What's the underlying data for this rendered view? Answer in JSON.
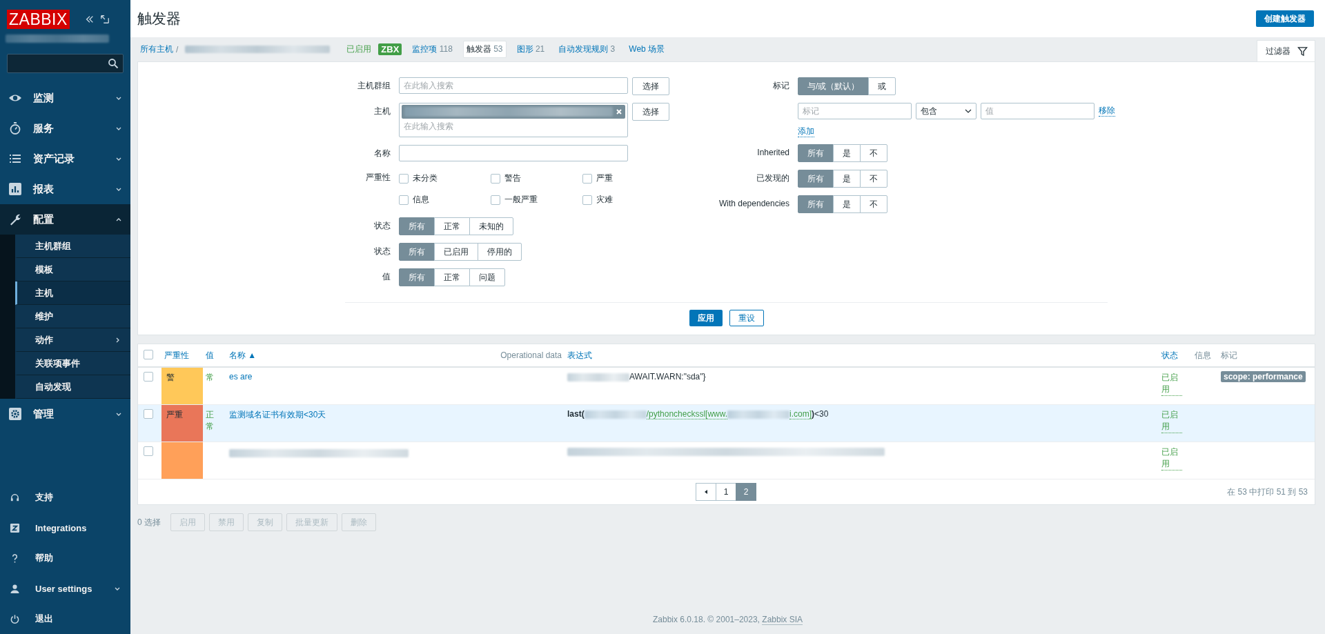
{
  "sidebar": {
    "logo": "ZABBIX",
    "menu": [
      {
        "label": "监测",
        "expanded": false
      },
      {
        "label": "服务",
        "expanded": false
      },
      {
        "label": "资产记录",
        "expanded": false
      },
      {
        "label": "报表",
        "expanded": false
      },
      {
        "label": "配置",
        "expanded": true,
        "children": [
          {
            "label": "主机群组",
            "selected": false,
            "submenu": false
          },
          {
            "label": "模板",
            "selected": false,
            "submenu": false
          },
          {
            "label": "主机",
            "selected": true,
            "submenu": false
          },
          {
            "label": "维护",
            "selected": false,
            "submenu": false
          },
          {
            "label": "动作",
            "selected": false,
            "submenu": true
          },
          {
            "label": "关联项事件",
            "selected": false,
            "submenu": false
          },
          {
            "label": "自动发现",
            "selected": false,
            "submenu": false
          }
        ]
      },
      {
        "label": "管理",
        "expanded": false
      }
    ],
    "bottom": [
      {
        "label": "支持",
        "submenu": false
      },
      {
        "label": "Integrations",
        "submenu": false
      },
      {
        "label": "帮助",
        "submenu": false
      },
      {
        "label": "User settings",
        "submenu": true
      },
      {
        "label": "退出",
        "submenu": false
      }
    ]
  },
  "header": {
    "title": "触发器",
    "create_button": "创建触发器"
  },
  "nav": {
    "all_hosts": "所有主机",
    "separator": "/",
    "host_status": "已启用",
    "zbx": "ZBX",
    "tabs": [
      {
        "label": "监控项",
        "count": "118",
        "selected": false
      },
      {
        "label": "触发器",
        "count": "53",
        "selected": true
      },
      {
        "label": "图形",
        "count": "21",
        "selected": false
      },
      {
        "label": "自动发现规则",
        "count": "3",
        "selected": false
      },
      {
        "label": "Web 场景",
        "selected": false
      }
    ],
    "filter_tab": "过滤器"
  },
  "filter": {
    "host_groups": {
      "label": "主机群组",
      "placeholder": "在此输入搜索",
      "button": "选择"
    },
    "host": {
      "label": "主机",
      "placeholder": "在此输入搜索",
      "button": "选择"
    },
    "name": {
      "label": "名称"
    },
    "severity": {
      "label": "严重性",
      "options": [
        {
          "label": "未分类",
          "checked": false
        },
        {
          "label": "警告",
          "checked": false
        },
        {
          "label": "严重",
          "checked": false
        },
        {
          "label": "信息",
          "checked": false
        },
        {
          "label": "一般严重",
          "checked": false
        },
        {
          "label": "灾难",
          "checked": false
        }
      ]
    },
    "left_groups": [
      {
        "label": "状态",
        "options": [
          {
            "label": "所有",
            "selected": true
          },
          {
            "label": "正常",
            "selected": false
          },
          {
            "label": "未知的",
            "selected": false
          }
        ]
      },
      {
        "label": "状态",
        "options": [
          {
            "label": "所有",
            "selected": true
          },
          {
            "label": "已启用",
            "selected": false
          },
          {
            "label": "停用的",
            "selected": false
          }
        ]
      },
      {
        "label": "值",
        "options": [
          {
            "label": "所有",
            "selected": true
          },
          {
            "label": "正常",
            "selected": false
          },
          {
            "label": "问题",
            "selected": false
          }
        ]
      }
    ],
    "tags": {
      "label": "标记",
      "options": [
        {
          "label": "与/或（默认）",
          "selected": true
        },
        {
          "label": "或",
          "selected": false
        }
      ],
      "tag_placeholder": "标记",
      "operator": "包含",
      "value_placeholder": "值",
      "remove": "移除",
      "add": "添加"
    },
    "right_groups": [
      {
        "label": "Inherited",
        "options": [
          {
            "label": "所有",
            "selected": true
          },
          {
            "label": "是",
            "selected": false
          },
          {
            "label": "不",
            "selected": false
          }
        ]
      },
      {
        "label": "已发现的",
        "options": [
          {
            "label": "所有",
            "selected": true
          },
          {
            "label": "是",
            "selected": false
          },
          {
            "label": "不",
            "selected": false
          }
        ]
      },
      {
        "label": "With dependencies",
        "options": [
          {
            "label": "所有",
            "selected": true
          },
          {
            "label": "是",
            "selected": false
          },
          {
            "label": "不",
            "selected": false
          }
        ]
      }
    ],
    "apply": "应用",
    "reset": "重设"
  },
  "table": {
    "columns": [
      "严重性",
      "值",
      "名称 ▲",
      "Operational data",
      "表达式",
      "状态",
      "信息",
      "标记"
    ],
    "header_checked": false,
    "rows": [
      {
        "checked": false,
        "severity": "警",
        "color": "#ffc859",
        "value": "常",
        "name": "es are",
        "expression": [
          {
            "kind": "blur"
          },
          {
            "kind": "text",
            "text": "AWAIT.WARN:\"sda\"}"
          }
        ],
        "status": "已启用",
        "tag": "scope: performance",
        "highlight": false
      },
      {
        "checked": false,
        "severity": "严重",
        "color": "#e97659",
        "value": "正常",
        "name": "监测域名证书有效期<30天",
        "expression": [
          {
            "kind": "func",
            "text": "last("
          },
          {
            "kind": "blur"
          },
          {
            "kind": "item",
            "text": "/pythoncheckssl[www."
          },
          {
            "kind": "blur"
          },
          {
            "kind": "item",
            "text": "i.com]"
          },
          {
            "kind": "func",
            "text": ")"
          },
          {
            "kind": "text",
            "text": "<30"
          }
        ],
        "status": "已启用",
        "highlight": true
      },
      {
        "checked": false,
        "color": "#ffa059",
        "expression": [
          {
            "kind": "blur"
          }
        ],
        "status": "已启用",
        "highlight": false
      }
    ],
    "pages": [
      {
        "label": "1",
        "selected": false
      },
      {
        "label": "2",
        "selected": true
      }
    ],
    "summary": "在 53 中打印 51 到 53"
  },
  "actions": {
    "selected": "0 选择",
    "buttons": [
      "启用",
      "禁用",
      "复制",
      "批量更新",
      "删除"
    ]
  },
  "footer": {
    "text": "Zabbix 6.0.18. © 2001–2023,",
    "link": "Zabbix SIA"
  }
}
